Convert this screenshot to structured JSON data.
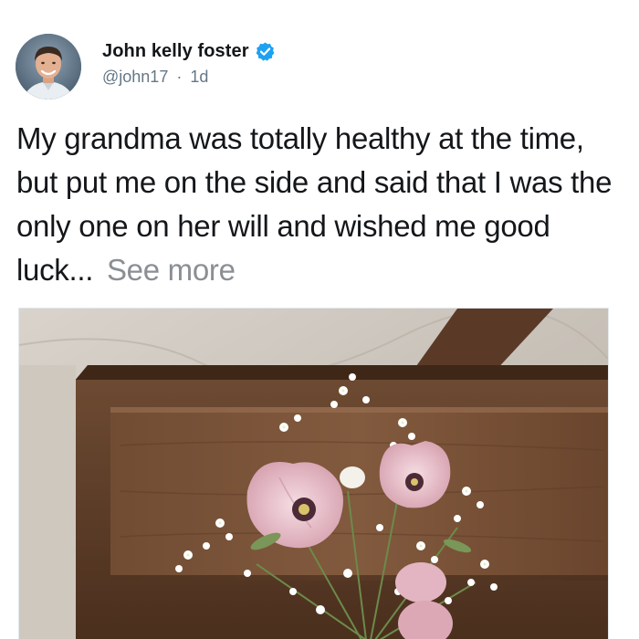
{
  "tweet": {
    "author": {
      "display_name": "John kelly foster",
      "handle": "@john17",
      "separator": "·",
      "timestamp": "1d",
      "verified": true,
      "avatar_icon": "avatar-photo"
    },
    "text": "My grandma was totally healthy at the time, but put me on the side and said that I was the only one on her will and wished me good luck...",
    "see_more_label": "See more",
    "media": {
      "icon": "coffin-with-flowers-photo"
    }
  },
  "colors": {
    "text_primary": "#14171a",
    "text_secondary": "#657786",
    "verified_badge": "#1da1f2",
    "see_more": "#8a8f94"
  }
}
